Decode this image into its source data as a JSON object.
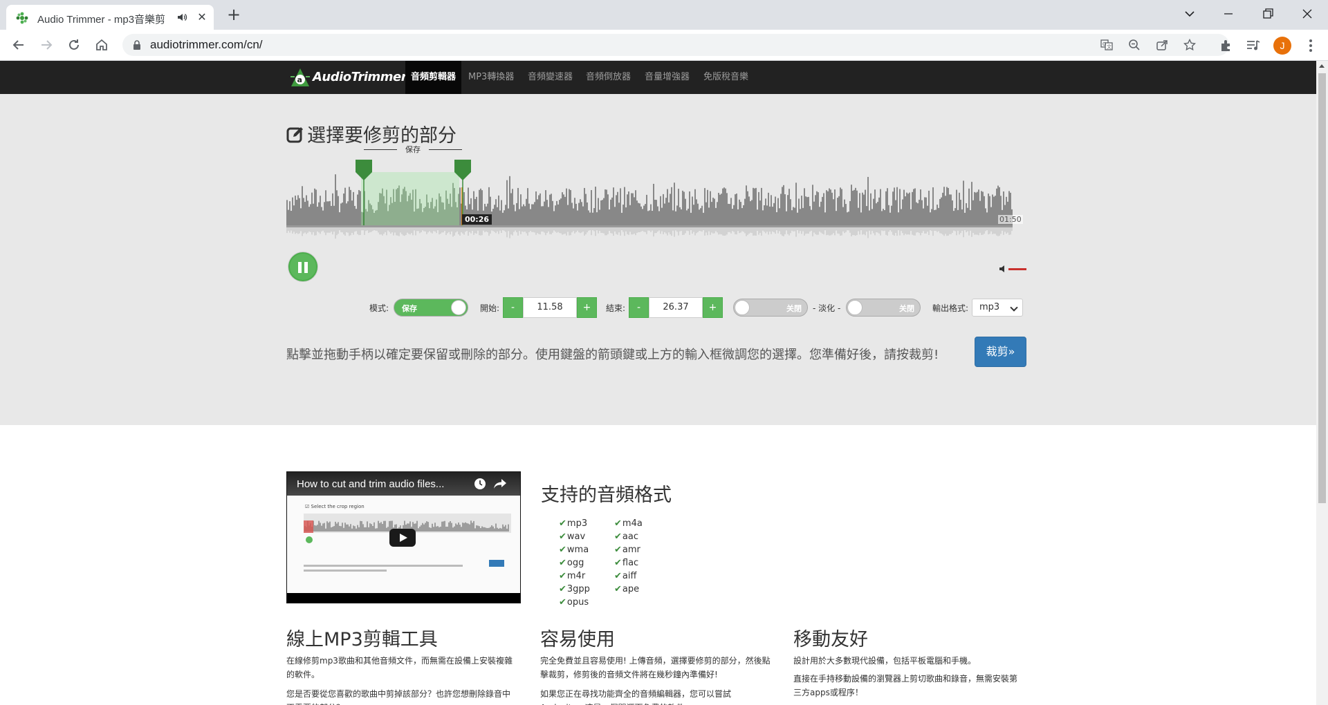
{
  "browser": {
    "tab_title": "Audio Trimmer - mp3音樂剪",
    "url": "audiotrimmer.com/cn/",
    "avatar_letter": "J",
    "new_tab_symbol": "+",
    "close_symbol": "✕"
  },
  "site": {
    "logo_text": "AudioTrimmer",
    "nav": [
      "音頻剪輯器",
      "MP3轉換器",
      "音頻變速器",
      "音頻倒放器",
      "音量增強器",
      "免版稅音樂"
    ],
    "active_nav": "音頻剪輯器",
    "brand_green": "#5cb85c",
    "button_blue": "#337ab7"
  },
  "editor": {
    "heading": "選擇要修剪的部分",
    "keep_label": "保存",
    "current_time": "00:26",
    "end_time": "01:50",
    "mode_label": "模式:",
    "mode_value": "保存",
    "start_label": "開始:",
    "start_value": "11.58",
    "end_label": "結束:",
    "end_value": "26.37",
    "minus": "-",
    "plus": "+",
    "fade_label": "- 淡化 -",
    "fade_in_value": "关閉",
    "fade_out_value": "关閉",
    "output_label": "輸出格式:",
    "output_value": "mp3",
    "crop_button": "裁剪»",
    "instructions": "點擊並拖動手柄以確定要保留或刪除的部分。使用鍵盤的箭頭鍵或上方的輸入框微調您的選擇。您準備好後，請按裁剪!"
  },
  "video": {
    "title": "How to cut and trim audio files..."
  },
  "formats": {
    "title": "支持的音頻格式",
    "col1": [
      "mp3",
      "wav",
      "wma",
      "ogg",
      "m4r",
      "3gpp",
      "opus"
    ],
    "col2": [
      "m4a",
      "aac",
      "amr",
      "flac",
      "aiff",
      "ape"
    ]
  },
  "features": [
    {
      "title": "線上MP3剪輯工具",
      "p1": "在線修剪mp3歌曲和其他音頻文件，而無需在設備上安裝複雜的軟件。",
      "p2": "您是否要從您喜歡的歌曲中剪掉該部分？也許您想刪除錄音中不需要的部分？"
    },
    {
      "title": "容易使用",
      "p1": "完全免費並且容易使用! 上傳音頻，選擇要修剪的部分，然後點擊裁剪，修剪後的音頻文件將在幾秒鐘內準備好!",
      "p2": "如果您正在尋找功能齊全的音頻編輯器，您可以嘗試Audacity，這是一個開源而免費的軟件。"
    },
    {
      "title": "移動友好",
      "p1": "設計用於大多數現代設備，包括平板電腦和手機。",
      "p2": "直接在手持移動設備的瀏覽器上剪切歌曲和錄音，無需安裝第三方apps或程序！"
    }
  ]
}
